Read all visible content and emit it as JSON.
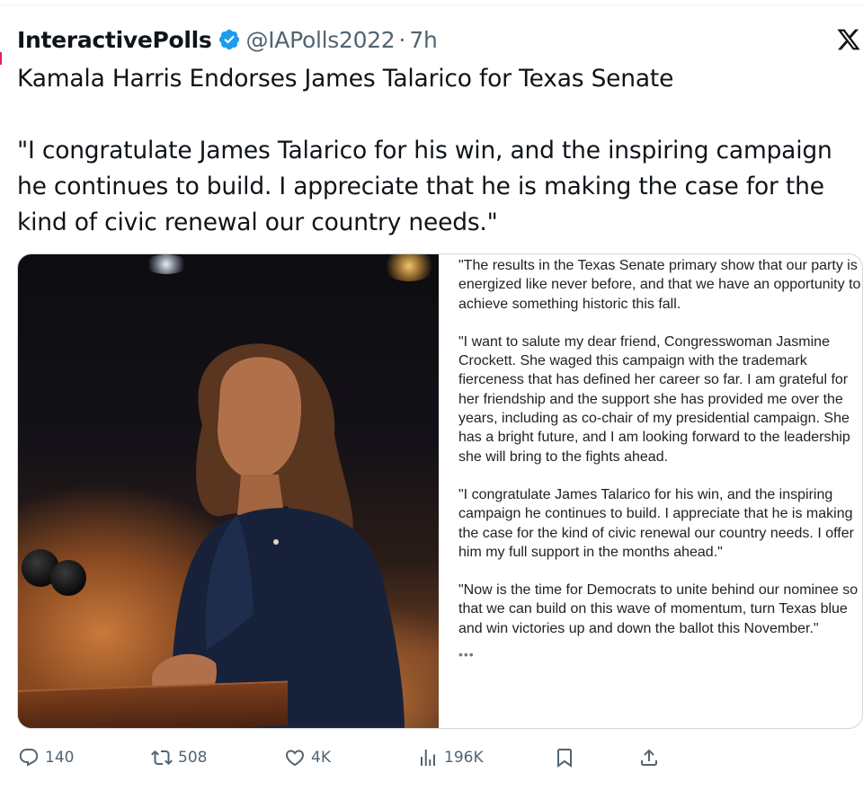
{
  "author": {
    "display_name": "InteractivePolls",
    "handle": "@IAPolls2022",
    "separator": "·",
    "time": "7h",
    "verified": true,
    "verified_color": "#1d9bf0"
  },
  "tweet": {
    "headline": "Kamala Harris Endorses James Talarico for Texas Senate",
    "quote": "\"I congratulate James Talarico for his win, and the inspiring campaign he continues to build. I appreciate that he is making the case for the kind of civic renewal our country needs.\""
  },
  "media": {
    "photo_icon": "photo-of-speaker",
    "statement_paragraphs": [
      "\"The results in the Texas Senate primary show that our party is energized like never before, and that we have an opportunity to achieve something historic this fall.",
      "\"I want to salute my dear friend, Congresswoman Jasmine Crockett. She waged this campaign with the trademark fierceness that has defined her career so far. I am grateful for her friendship and the support she has provided me over the years, including as co-chair of my presidential campaign. She has a bright future, and I am looking forward to the leadership she will bring to the fights ahead.",
      "\"I congratulate James Talarico for his win, and the inspiring campaign he continues to build. I appreciate that he is making the case for the kind of civic renewal our country needs. I offer him my full support in the months ahead.\"",
      "\"Now is the time for Democrats to unite behind our nominee so that we can build on this wave of momentum, turn Texas blue and win victories up and down the ballot this November.\""
    ],
    "ellipsis": "•••"
  },
  "actions": {
    "replies": "140",
    "reposts": "508",
    "likes": "4K",
    "views": "196K"
  },
  "icons": {
    "platform": "x-logo-icon",
    "reply": "reply-icon",
    "repost": "repost-icon",
    "like": "heart-icon",
    "views": "views-chart-icon",
    "bookmark": "bookmark-icon",
    "share": "share-icon"
  },
  "colors": {
    "text": "#0f1419",
    "secondary": "#536471",
    "border": "#cfd9de"
  }
}
